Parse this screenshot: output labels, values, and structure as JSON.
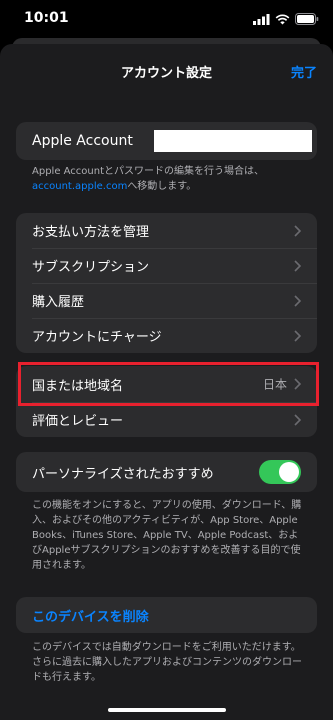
{
  "status": {
    "time": "10:01"
  },
  "nav": {
    "title": "アカウント設定",
    "done": "完了"
  },
  "apple_account": {
    "label": "Apple Account",
    "footnote_text": "Apple Accountとパスワードの編集を行う場合は、",
    "footnote_link": "account.apple.com",
    "footnote_suffix": "へ移動します。"
  },
  "payment_group": [
    {
      "label": "お支払い方法を管理"
    },
    {
      "label": "サブスクリプション"
    },
    {
      "label": "購入履歴"
    },
    {
      "label": "アカウントにチャージ"
    }
  ],
  "region_group": [
    {
      "label": "国または地域名",
      "value": "日本"
    },
    {
      "label": "評価とレビュー"
    }
  ],
  "personalized": {
    "label": "パーソナライズされたおすすめ",
    "enabled": true,
    "footnote": "この機能をオンにすると、アプリの使用、ダウンロード、購入、およびその他のアクティビティが、App Store、Apple Books、iTunes Store、Apple TV、Apple Podcast、およびAppleサブスクリプションのおすすめを改善する目的で使用されます。"
  },
  "device": {
    "remove_label": "このデバイスを削除",
    "footnote": "このデバイスでは自動ダウンロードをご利用いただけます。さらに過去に購入したアプリおよびコンテンツのダウンロードも行えます。"
  },
  "colors": {
    "accent": "#0a84ff",
    "toggle_on": "#34c759",
    "highlight": "#e8212e"
  }
}
